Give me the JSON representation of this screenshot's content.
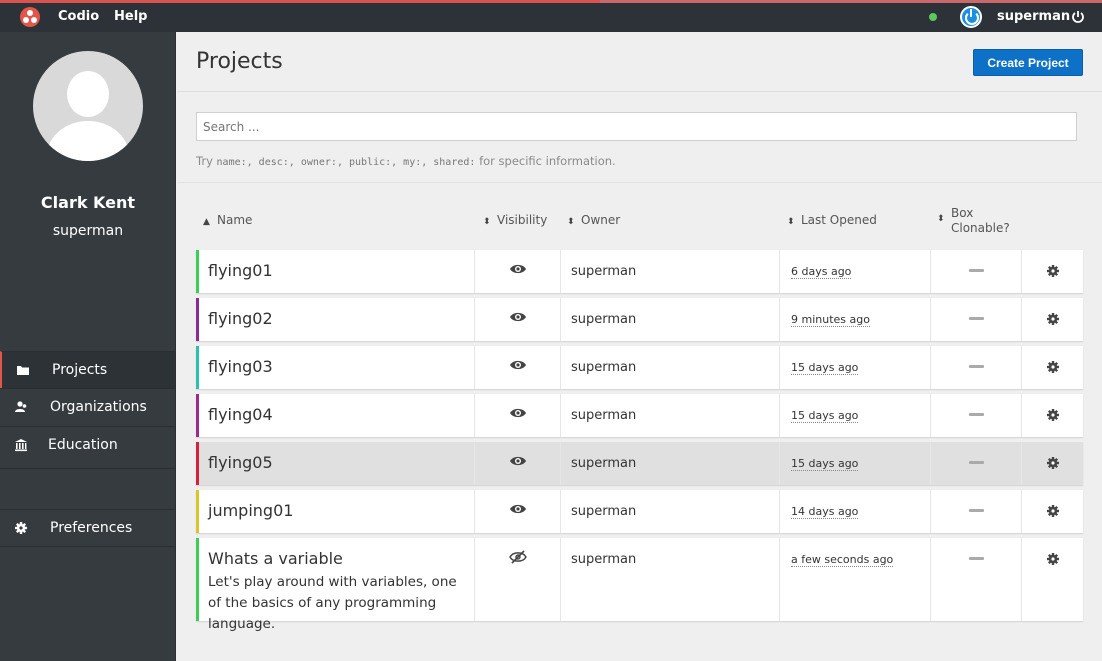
{
  "topbar": {
    "brand": "Codio",
    "help": "Help",
    "username": "superman",
    "colors": {
      "accent": "#e25549",
      "online": "#5cc85c",
      "badge": "#1d8fe0"
    }
  },
  "sidebar": {
    "full_name": "Clark Kent",
    "handle": "superman",
    "items": [
      {
        "label": "Projects",
        "icon": "folder-icon",
        "active": true
      },
      {
        "label": "Organizations",
        "icon": "users-icon",
        "active": false
      },
      {
        "label": "Education",
        "icon": "bank-icon",
        "active": false
      },
      {
        "label": "Preferences",
        "icon": "gear-icon",
        "active": false
      }
    ]
  },
  "main": {
    "title": "Projects",
    "create_label": "Create Project",
    "search_placeholder": "Search ...",
    "hint": {
      "prefix": "Try ",
      "keys": "name:, desc:, owner:, public:, my:, shared:",
      "suffix": " for specific information."
    },
    "columns": {
      "name": "Name",
      "visibility": "Visibility",
      "owner": "Owner",
      "last_opened": "Last Opened",
      "box_clonable": "Box Clonable?"
    }
  },
  "projects": [
    {
      "name": "flying01",
      "owner": "superman",
      "opened": "6 days ago",
      "visible": true,
      "color": "#3ccf53"
    },
    {
      "name": "flying02",
      "owner": "superman",
      "opened": "9 minutes ago",
      "visible": true,
      "color": "#8a2b93"
    },
    {
      "name": "flying03",
      "owner": "superman",
      "opened": "15 days ago",
      "visible": true,
      "color": "#2bc1b1"
    },
    {
      "name": "flying04",
      "owner": "superman",
      "opened": "15 days ago",
      "visible": true,
      "color": "#9a2c8e"
    },
    {
      "name": "flying05",
      "owner": "superman",
      "opened": "15 days ago",
      "visible": true,
      "color": "#d2233a"
    },
    {
      "name": "jumping01",
      "owner": "superman",
      "opened": "14 days ago",
      "visible": true,
      "color": "#d8c72a"
    },
    {
      "name": "Whats a variable",
      "description": "Let's play around with variables, one of the basics of any programming language.",
      "owner": "superman",
      "opened": "a few seconds ago",
      "visible": false,
      "color": "#3ccf53"
    }
  ]
}
